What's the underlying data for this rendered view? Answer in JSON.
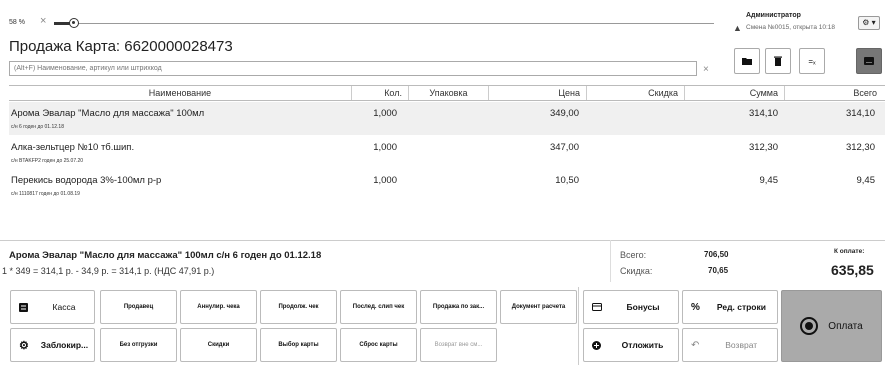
{
  "top": {
    "zoom": "58 %",
    "zoom_clear": "×",
    "zoom_fraction": 0.03,
    "user": {
      "name": "Администратор",
      "shift": "Смена №0015, открыта 10:18"
    },
    "settings": "⚙ ▾"
  },
  "sale": {
    "title": "Продажа Карта: 6620000028473"
  },
  "search": {
    "placeholder": "(Alt+F) Наименование, артикул или штрихкод",
    "clear": "×"
  },
  "table": {
    "headers": [
      "Наименование",
      "Кол.",
      "Упаковка",
      "Цена",
      "Скидка",
      "Сумма",
      "Всего"
    ],
    "rows": [
      {
        "name": "Арома Эвалар \"Масло для массажа\" 100мл",
        "sub": "с/н 6 годен до 01.12.18",
        "qty": "1,000",
        "pack": "",
        "price": "349,00",
        "disc": "",
        "sum": "314,10",
        "total": "314,10",
        "selected": true
      },
      {
        "name": "Алка-зельтцер №10 тб.шип.",
        "sub": "с/н BTAKFP2 годен до 25.07.20",
        "qty": "1,000",
        "pack": "",
        "price": "347,00",
        "disc": "",
        "sum": "312,30",
        "total": "312,30",
        "selected": false
      },
      {
        "name": "Перекись водорода 3%-100мл р-р",
        "sub": "с/н 1110817 годен до 01.08.19",
        "qty": "1,000",
        "pack": "",
        "price": "10,50",
        "disc": "",
        "sum": "9,45",
        "total": "9,45",
        "selected": false
      }
    ]
  },
  "summary": {
    "item": "Арома Эвалар \"Масло для массажа\" 100мл с/н 6 годен до 01.12.18",
    "calc": "1 * 349 = 314,1 р. - 34,9 р. = 314,1 р. (НДС 47,91 р.)",
    "total_label": "Всего:",
    "total_value": "706,50",
    "discount_label": "Скидка:",
    "discount_value": "70,65",
    "pay_label": "К оплате:",
    "pay_value": "635,85"
  },
  "buttons": {
    "kassa": "Касса",
    "seller": "Продавец",
    "cancel_check": "Аннулир. чека",
    "continue_check": "Продолж. чек",
    "last_slip": "Послед. слип чек",
    "order_sale": "Продажа по зак...",
    "calc_doc": "Документ расчета",
    "bonuses": "Бонусы",
    "edit_row": "Ред. строки",
    "lock": "Заблокир...",
    "no_shipment": "Без отгрузки",
    "discounts": "Скидки",
    "card_select": "Выбор карты",
    "card_reset": "Сброс карты",
    "return_outside": "Возврат вне см...",
    "postpone": "Отложить",
    "return": "Возврат",
    "pay": "Оплата"
  }
}
